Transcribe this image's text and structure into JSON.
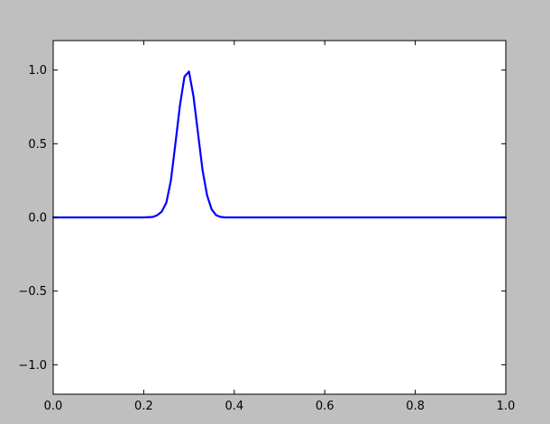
{
  "figure": {
    "background_color": "#bfbfbf",
    "axes_background_color": "#ffffff"
  },
  "chart_data": {
    "type": "line",
    "title": "",
    "xlabel": "",
    "ylabel": "",
    "xlim": [
      0.0,
      1.0
    ],
    "ylim": [
      -1.2,
      1.2
    ],
    "grid": false,
    "x_ticks": [
      0.0,
      0.2,
      0.4,
      0.6,
      0.8,
      1.0
    ],
    "x_tick_labels": [
      "0.0",
      "0.2",
      "0.4",
      "0.6",
      "0.8",
      "1.0"
    ],
    "y_ticks": [
      -1.0,
      -0.5,
      0.0,
      0.5,
      1.0
    ],
    "y_tick_labels": [
      "−1.0",
      "−0.5",
      "0.0",
      "0.5",
      "1.0"
    ],
    "series": [
      {
        "color": "#0000ff",
        "x": [
          0.0,
          0.05,
          0.1,
          0.15,
          0.2,
          0.22,
          0.23,
          0.24,
          0.25,
          0.26,
          0.27,
          0.28,
          0.29,
          0.3,
          0.31,
          0.32,
          0.33,
          0.34,
          0.35,
          0.36,
          0.37,
          0.38,
          0.4,
          0.5,
          0.6,
          0.7,
          0.8,
          0.9,
          1.0
        ],
        "y": [
          0.0,
          0.0,
          0.0,
          0.0,
          0.0,
          0.003,
          0.015,
          0.04,
          0.1,
          0.25,
          0.5,
          0.76,
          0.955,
          0.99,
          0.82,
          0.57,
          0.32,
          0.15,
          0.055,
          0.015,
          0.003,
          0.0,
          0.0,
          0.0,
          0.0,
          0.0,
          0.0,
          0.0,
          0.0
        ]
      }
    ]
  }
}
